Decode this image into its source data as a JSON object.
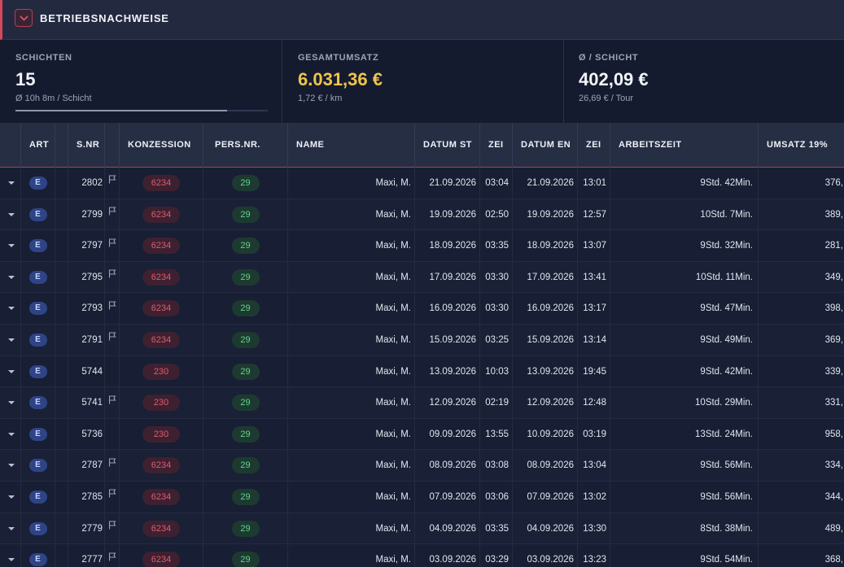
{
  "header": {
    "title": "BETRIEBSNACHWEISE",
    "collapse_icon": "chevron-down-icon",
    "accent": "#d4485b"
  },
  "stats": [
    {
      "label": "SCHICHTEN",
      "value": "15",
      "sub": "Ø 10h 8m / Schicht",
      "progress": 0.84
    },
    {
      "label": "GESAMTUMSATZ",
      "value": "6.031,36 €",
      "sub": "1,72 € / km",
      "value_color": "#efc54a"
    },
    {
      "label": "Ø / SCHICHT",
      "value": "402,09 €",
      "sub": "26,69 € / Tour"
    }
  ],
  "table": {
    "columns": [
      "ART",
      "S.NR",
      "KONZESSION",
      "PERS.NR.",
      "NAME",
      "DATUM ST",
      "ZEI",
      "DATUM EN",
      "ZEI",
      "ARBEITSZEIT",
      "UMSATZ 19%"
    ],
    "rows": [
      {
        "art": "E",
        "snr": "2802",
        "flag": true,
        "konzession": "6234",
        "persnr": "29",
        "name": "Maxi, M.",
        "datum_start": "21.09.2026",
        "zeit_start": "03:04",
        "datum_ende": "21.09.2026",
        "zeit_ende": "13:01",
        "arbeitszeit": "9Std. 42Min.",
        "umsatz": "376,"
      },
      {
        "art": "E",
        "snr": "2799",
        "flag": true,
        "konzession": "6234",
        "persnr": "29",
        "name": "Maxi, M.",
        "datum_start": "19.09.2026",
        "zeit_start": "02:50",
        "datum_ende": "19.09.2026",
        "zeit_ende": "12:57",
        "arbeitszeit": "10Std. 7Min.",
        "umsatz": "389,"
      },
      {
        "art": "E",
        "snr": "2797",
        "flag": true,
        "konzession": "6234",
        "persnr": "29",
        "name": "Maxi, M.",
        "datum_start": "18.09.2026",
        "zeit_start": "03:35",
        "datum_ende": "18.09.2026",
        "zeit_ende": "13:07",
        "arbeitszeit": "9Std. 32Min.",
        "umsatz": "281,"
      },
      {
        "art": "E",
        "snr": "2795",
        "flag": true,
        "konzession": "6234",
        "persnr": "29",
        "name": "Maxi, M.",
        "datum_start": "17.09.2026",
        "zeit_start": "03:30",
        "datum_ende": "17.09.2026",
        "zeit_ende": "13:41",
        "arbeitszeit": "10Std. 11Min.",
        "umsatz": "349,"
      },
      {
        "art": "E",
        "snr": "2793",
        "flag": true,
        "konzession": "6234",
        "persnr": "29",
        "name": "Maxi, M.",
        "datum_start": "16.09.2026",
        "zeit_start": "03:30",
        "datum_ende": "16.09.2026",
        "zeit_ende": "13:17",
        "arbeitszeit": "9Std. 47Min.",
        "umsatz": "398,"
      },
      {
        "art": "E",
        "snr": "2791",
        "flag": true,
        "konzession": "6234",
        "persnr": "29",
        "name": "Maxi, M.",
        "datum_start": "15.09.2026",
        "zeit_start": "03:25",
        "datum_ende": "15.09.2026",
        "zeit_ende": "13:14",
        "arbeitszeit": "9Std. 49Min.",
        "umsatz": "369,"
      },
      {
        "art": "E",
        "snr": "5744",
        "flag": false,
        "konzession": "230",
        "persnr": "29",
        "name": "Maxi, M.",
        "datum_start": "13.09.2026",
        "zeit_start": "10:03",
        "datum_ende": "13.09.2026",
        "zeit_ende": "19:45",
        "arbeitszeit": "9Std. 42Min.",
        "umsatz": "339,"
      },
      {
        "art": "E",
        "snr": "5741",
        "flag": true,
        "konzession": "230",
        "persnr": "29",
        "name": "Maxi, M.",
        "datum_start": "12.09.2026",
        "zeit_start": "02:19",
        "datum_ende": "12.09.2026",
        "zeit_ende": "12:48",
        "arbeitszeit": "10Std. 29Min.",
        "umsatz": "331,"
      },
      {
        "art": "E",
        "snr": "5736",
        "flag": false,
        "konzession": "230",
        "persnr": "29",
        "name": "Maxi, M.",
        "datum_start": "09.09.2026",
        "zeit_start": "13:55",
        "datum_ende": "10.09.2026",
        "zeit_ende": "03:19",
        "arbeitszeit": "13Std. 24Min.",
        "umsatz": "958,"
      },
      {
        "art": "E",
        "snr": "2787",
        "flag": true,
        "konzession": "6234",
        "persnr": "29",
        "name": "Maxi, M.",
        "datum_start": "08.09.2026",
        "zeit_start": "03:08",
        "datum_ende": "08.09.2026",
        "zeit_ende": "13:04",
        "arbeitszeit": "9Std. 56Min.",
        "umsatz": "334,"
      },
      {
        "art": "E",
        "snr": "2785",
        "flag": true,
        "konzession": "6234",
        "persnr": "29",
        "name": "Maxi, M.",
        "datum_start": "07.09.2026",
        "zeit_start": "03:06",
        "datum_ende": "07.09.2026",
        "zeit_ende": "13:02",
        "arbeitszeit": "9Std. 56Min.",
        "umsatz": "344,"
      },
      {
        "art": "E",
        "snr": "2779",
        "flag": true,
        "konzession": "6234",
        "persnr": "29",
        "name": "Maxi, M.",
        "datum_start": "04.09.2026",
        "zeit_start": "03:35",
        "datum_ende": "04.09.2026",
        "zeit_ende": "13:30",
        "arbeitszeit": "8Std. 38Min.",
        "umsatz": "489,"
      },
      {
        "art": "E",
        "snr": "2777",
        "flag": true,
        "konzession": "6234",
        "persnr": "29",
        "name": "Maxi, M.",
        "datum_start": "03.09.2026",
        "zeit_start": "03:29",
        "datum_ende": "03.09.2026",
        "zeit_ende": "13:23",
        "arbeitszeit": "9Std. 54Min.",
        "umsatz": "368,"
      }
    ]
  }
}
